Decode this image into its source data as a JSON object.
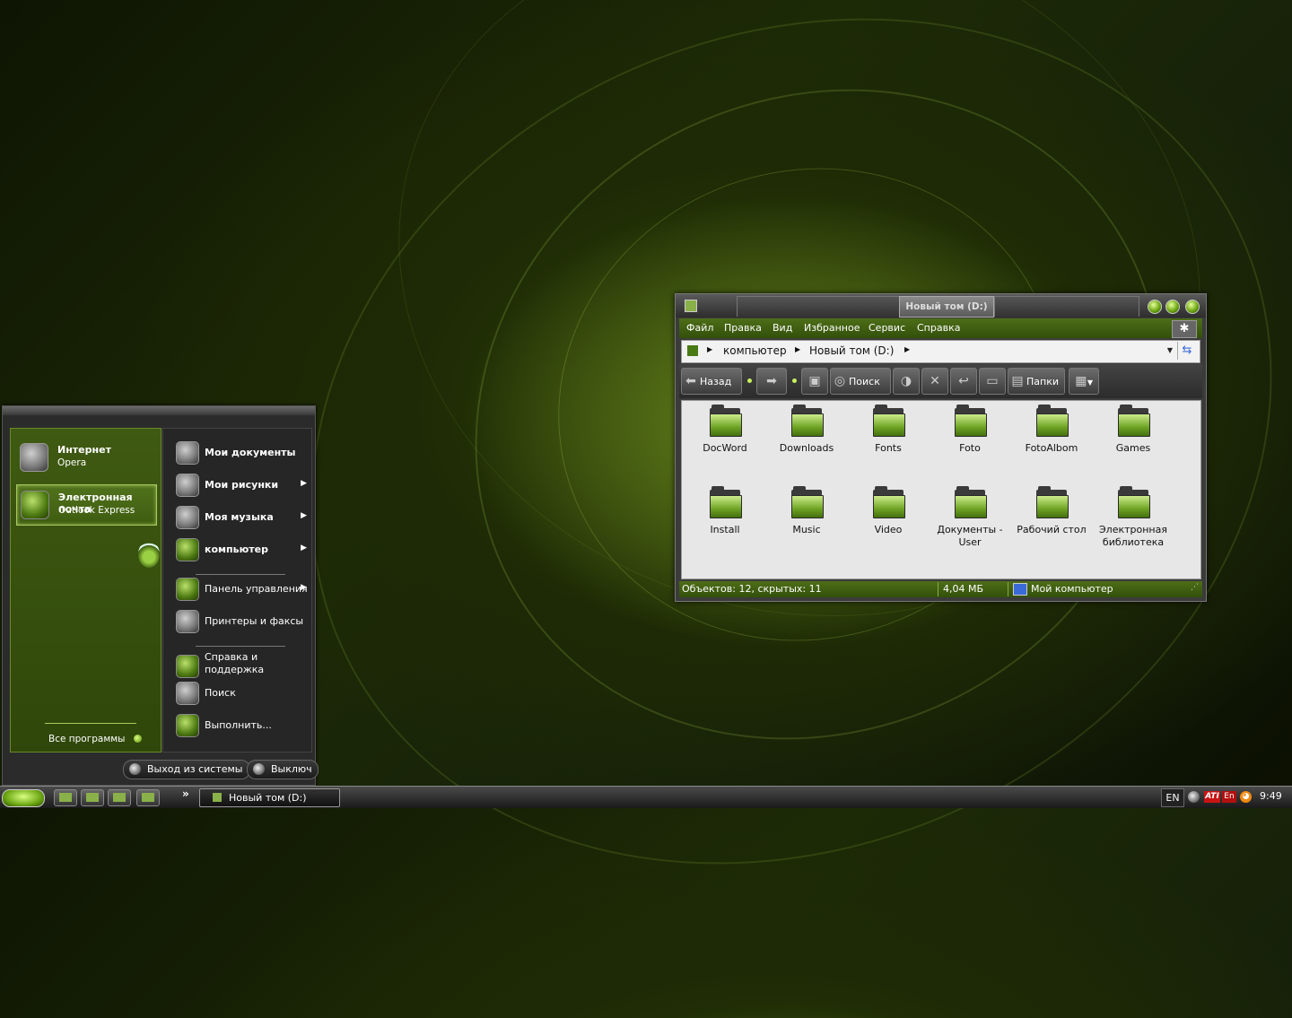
{
  "start_menu": {
    "pinned": [
      {
        "title": "Интернет",
        "subtitle": "Opera"
      },
      {
        "title": "Электронная почта",
        "subtitle": "Outlook Express"
      }
    ],
    "all_programs": "Все программы",
    "right_items": [
      {
        "label": "Мои документы",
        "arrow": ""
      },
      {
        "label": "Мои рисунки",
        "arrow": "▶"
      },
      {
        "label": "Моя музыка",
        "arrow": "▶"
      },
      {
        "label": "компьютер",
        "arrow": "▶"
      },
      {
        "label": "Панель управления",
        "arrow": "▶"
      },
      {
        "label": "Принтеры и факсы",
        "arrow": ""
      },
      {
        "label": "Справка и поддержка",
        "arrow": ""
      },
      {
        "label": "Поиск",
        "arrow": ""
      },
      {
        "label": "Выполнить...",
        "arrow": ""
      }
    ],
    "logoff": "Выход из системы",
    "shutdown": "Выключ"
  },
  "explorer": {
    "title": "Новый том (D:)",
    "menu": [
      "Файл",
      "Правка",
      "Вид",
      "Избранное",
      "Сервис",
      "Справка"
    ],
    "address": {
      "segments": [
        "компьютер",
        "Новый том (D:)"
      ]
    },
    "toolbar": {
      "back": "Назад",
      "search": "Поиск",
      "folders": "Папки"
    },
    "folders": [
      "DocWord",
      "Downloads",
      "Fonts",
      "Foto",
      "FotoAlbom",
      "Games",
      "Install",
      "Music",
      "Video",
      "Документы - User",
      "Рабочий  стол",
      "Электронная библиотека"
    ],
    "status": {
      "objects": "Объектов: 12, скрытых: 11",
      "size": "4,04 МБ",
      "location": "Мой компьютер"
    }
  },
  "taskbar": {
    "chevron": "»",
    "tasks": [
      {
        "label": "Новый том (D:)"
      }
    ],
    "tray": {
      "lang": "EN",
      "ati": "ATI",
      "en_icon": "En",
      "clock": "9:49"
    }
  },
  "colors": {
    "accent": "#4e6e18",
    "highlight": "#a8c860"
  }
}
